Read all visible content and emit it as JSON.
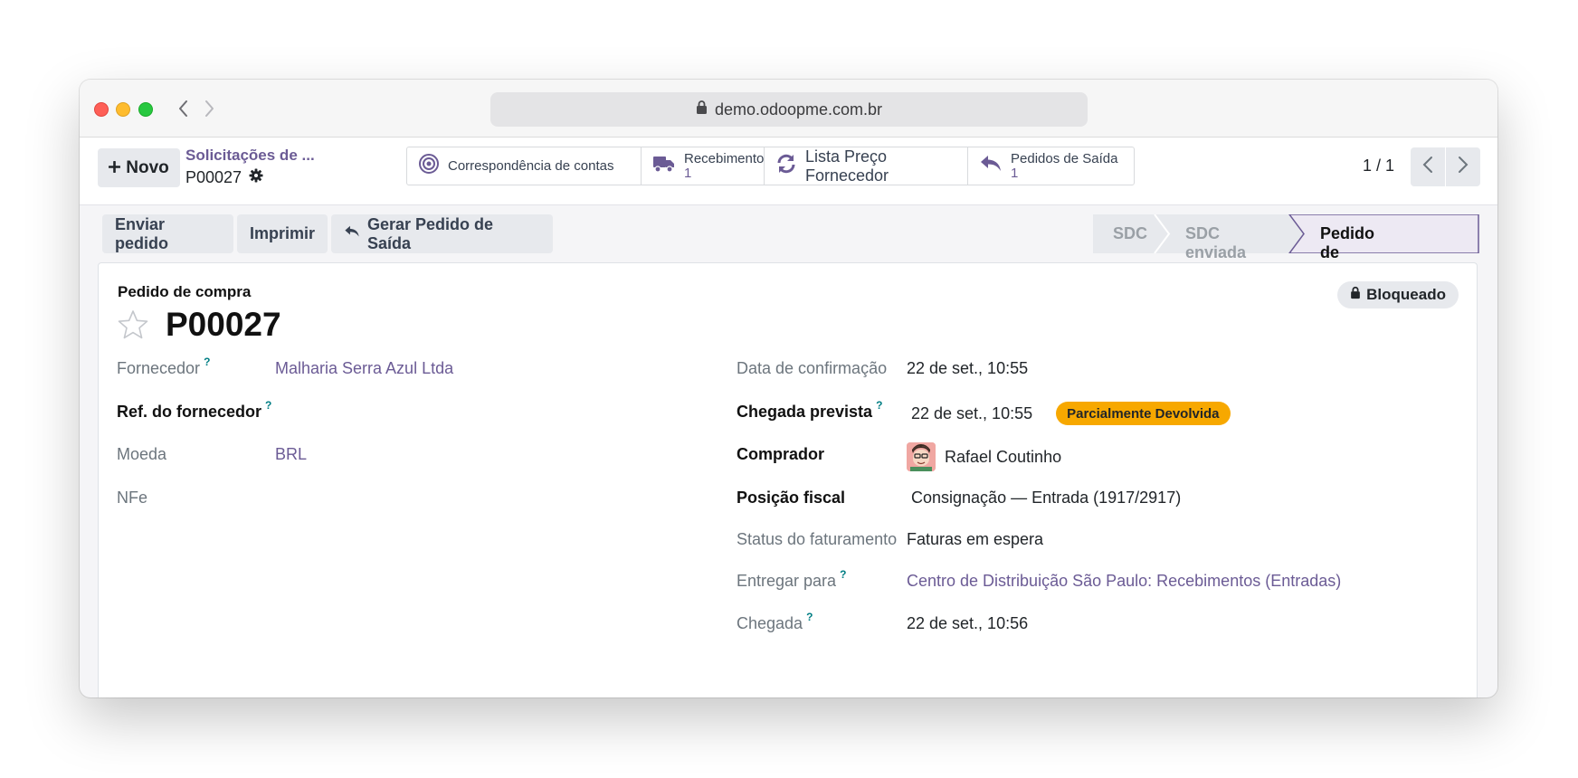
{
  "browser": {
    "url": "demo.odoopme.com.br"
  },
  "control_panel": {
    "new_button": "Novo",
    "breadcrumb_parent": "Solicitações de ...",
    "breadcrumb_current": "P00027",
    "smart_buttons": {
      "correspondencia": "Correspondência de contas",
      "recebimento_label": "Recebimento",
      "recebimento_count": "1",
      "lista_preco": "Lista Preço Fornecedor",
      "pedidos_saida_label": "Pedidos de Saída",
      "pedidos_saida_count": "1"
    },
    "pager": "1 / 1"
  },
  "actions": {
    "enviar": "Enviar pedido",
    "imprimir": "Imprimir",
    "gerar": "Gerar Pedido de Saída"
  },
  "statusbar": {
    "stages": [
      "SDC",
      "SDC enviada",
      "Pedido de compra"
    ],
    "active_index": 2
  },
  "form": {
    "doc_type": "Pedido de compra",
    "doc_name": "P00027",
    "locked_badge": "Bloqueado",
    "help_mark": "?",
    "left": {
      "fornecedor_label": "Fornecedor",
      "fornecedor_value": "Malharia Serra Azul Ltda",
      "ref_label": "Ref. do fornecedor",
      "moeda_label": "Moeda",
      "moeda_value": "BRL",
      "nfe_label": "NFe"
    },
    "right": {
      "data_confirmacao_label": "Data de confirmação",
      "data_confirmacao_value": "22 de set., 10:55",
      "chegada_prevista_label": "Chegada prevista",
      "chegada_prevista_value": "22 de set., 10:55",
      "chegada_prevista_status": "Parcialmente Devolvida",
      "comprador_label": "Comprador",
      "comprador_value": "Rafael Coutinho",
      "posicao_fiscal_label": "Posição fiscal",
      "posicao_fiscal_value": "Consignação — Entrada (1917/2917)",
      "status_fat_label": "Status do faturamento",
      "status_fat_value": "Faturas em espera",
      "entregar_label": "Entregar para",
      "entregar_value": "Centro de Distribuição São Paulo: Recebimentos (Entradas)",
      "chegada_label": "Chegada",
      "chegada_value": "22 de set., 10:56"
    }
  },
  "colors": {
    "accent": "#6b5b95",
    "status_pill": "#f7a800",
    "help_mark": "#017e84"
  }
}
